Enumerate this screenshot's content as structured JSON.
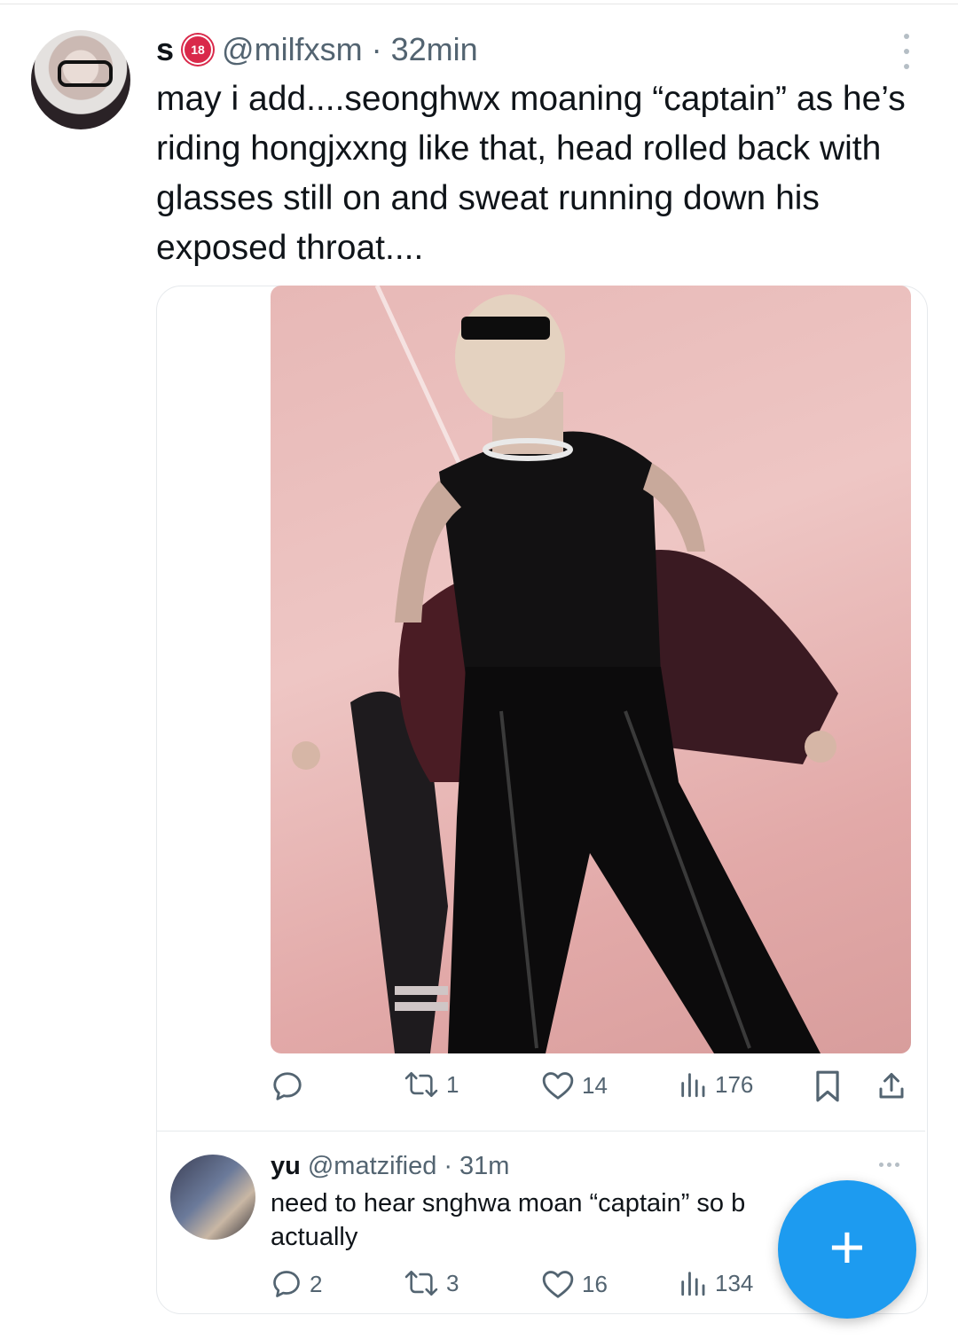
{
  "tweet": {
    "author_name": "s",
    "badge": "18",
    "handle": "@milfxsm",
    "separator": "·",
    "time": "32min",
    "text": "may i add....seonghwx moaning “captain” as he’s riding hongjxxng like that, head rolled back with glasses still on and sweat running down his exposed throat....",
    "media_icon": "photo",
    "actions": {
      "reply_count": "",
      "retweet_count": "1",
      "like_count": "14",
      "view_count": "176"
    }
  },
  "reply": {
    "author_name": "yu",
    "handle": "@matzified",
    "separator": "·",
    "time": "31m",
    "text": "need to hear snghwa moan “captain” so b",
    "text_line2": "actually",
    "actions": {
      "reply_count": "2",
      "retweet_count": "3",
      "like_count": "16",
      "view_count": "134"
    }
  },
  "fab": {
    "label": "+"
  },
  "colors": {
    "accent": "#1d9bf0",
    "muted": "#536471",
    "badge": "#d9294a"
  },
  "icons": [
    "more-vertical-icon",
    "reply-icon",
    "retweet-icon",
    "like-icon",
    "views-icon",
    "bookmark-icon",
    "share-icon",
    "more-horizontal-icon",
    "plus-icon"
  ]
}
